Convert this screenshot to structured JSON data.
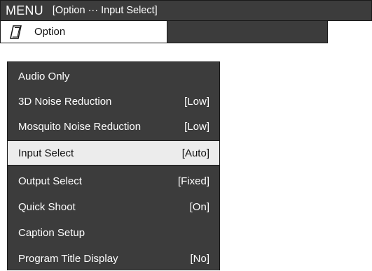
{
  "header": {
    "menu_label": "MENU",
    "breadcrumb": "[Option ··· Input Select]"
  },
  "tab": {
    "icon": "note-icon",
    "label": "Option"
  },
  "menu": {
    "items": [
      {
        "label": "Audio Only",
        "value": ""
      },
      {
        "label": "3D Noise Reduction",
        "value": "[Low]"
      },
      {
        "label": "Mosquito Noise Reduction",
        "value": "[Low]"
      },
      {
        "label": "Input Select",
        "value": "[Auto]"
      },
      {
        "label": "Output Select",
        "value": "[Fixed]"
      },
      {
        "label": "Quick Shoot",
        "value": "[On]"
      },
      {
        "label": "Caption Setup",
        "value": ""
      },
      {
        "label": "Program Title Display",
        "value": "[No]"
      }
    ],
    "selected_label": "Input Select"
  },
  "colors": {
    "panel": "#3c3c3c",
    "highlight": "#ececec"
  }
}
